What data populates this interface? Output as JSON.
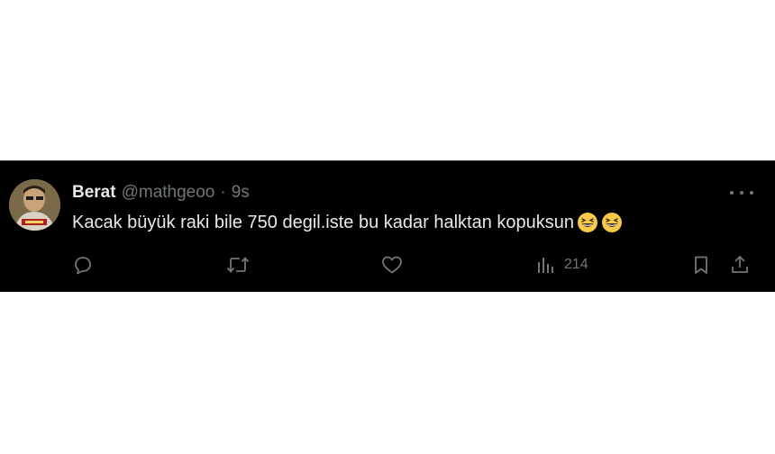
{
  "tweet": {
    "display_name": "Berat",
    "handle": "@mathgeoo",
    "separator": "·",
    "time": "9s",
    "text": "Kacak büyük raki bile 750 degil.iste bu kadar halktan kopuksun",
    "emojis": [
      "grinning-squinting-face",
      "grinning-squinting-face"
    ],
    "avatar": "avatar-photo",
    "more_icon": "more-options-icon"
  },
  "actions": {
    "reply": {
      "icon": "reply-icon"
    },
    "retweet": {
      "icon": "retweet-icon"
    },
    "like": {
      "icon": "heart-icon"
    },
    "views": {
      "icon": "views-chart-icon",
      "count": "214"
    },
    "bookmark": {
      "icon": "bookmark-icon"
    },
    "share": {
      "icon": "share-icon"
    }
  },
  "colors": {
    "background": "#000000",
    "text_primary": "#e7e9ea",
    "text_secondary": "#71767b",
    "page_background": "#ffffff"
  }
}
